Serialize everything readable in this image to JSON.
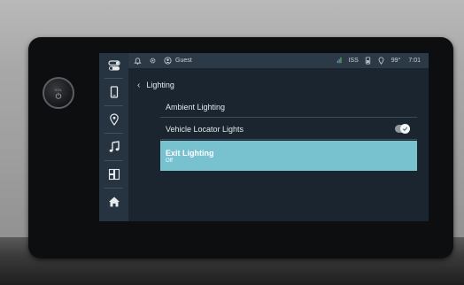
{
  "device": {
    "knob_label": "VOL",
    "knob_icon": "power-icon"
  },
  "status_bar": {
    "user": "Guest",
    "station": "ISS",
    "temperature": "99°",
    "time": "7:01"
  },
  "sidebar": {
    "items": [
      {
        "icon": "toggle-switch-icon"
      },
      {
        "icon": "phone-icon"
      },
      {
        "icon": "location-pin-icon"
      },
      {
        "icon": "music-note-icon"
      },
      {
        "icon": "apps-grid-icon"
      },
      {
        "icon": "home-icon"
      }
    ]
  },
  "page": {
    "back_title": "Lighting",
    "items": [
      {
        "label": "Ambient Lighting"
      },
      {
        "label": "Vehicle Locator Lights",
        "toggle_on": true
      },
      {
        "label": "Exit Lighting",
        "value": "Off",
        "selected": true
      }
    ]
  },
  "colors": {
    "accent": "#78c2cf",
    "screen_bg": "#1b2530",
    "sidebar_bg": "#263340"
  }
}
